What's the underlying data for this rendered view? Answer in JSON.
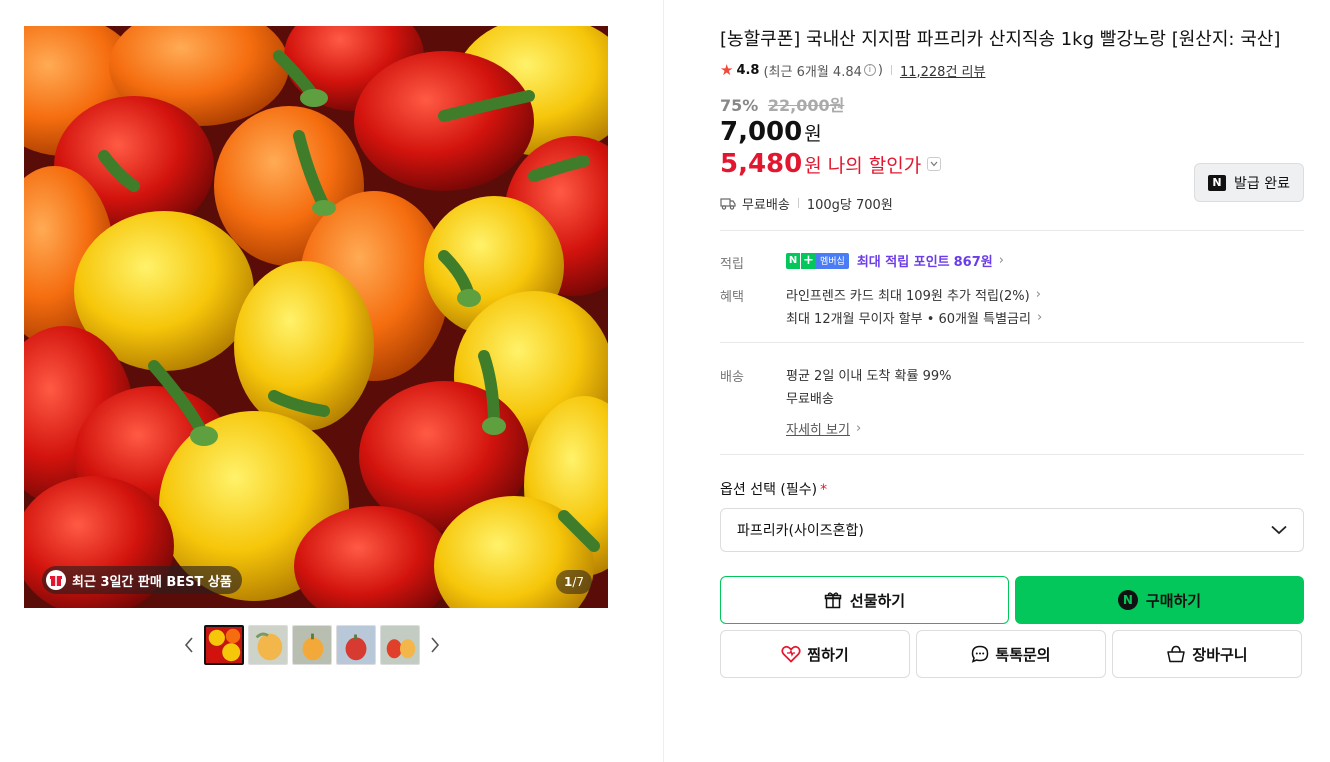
{
  "gallery": {
    "best_badge": "최근 3일간 판매 BEST 상품",
    "counter_current": "1",
    "counter_total": "/7",
    "thumb_count": 5,
    "active_thumb": 0
  },
  "product": {
    "title": "[농할쿠폰] 국내산 지지팜 파프리카 산지직송 1kg 빨강노랑 [원산지: 국산]",
    "rating": "4.8",
    "recent_rating": "(최근 6개월 4.84",
    "recent_rating_close": ")",
    "review_count": "11,228건 리뷰",
    "discount_rate": "75%",
    "original_price": "22,000원",
    "price": "7,000",
    "price_unit": "원",
    "my_price": "5,480",
    "my_price_unit": "원",
    "my_price_label": "나의 할인가",
    "coupon_button": "발급 완료",
    "shipping": "무료배송",
    "unit_price": "100g당 700원"
  },
  "benefits": {
    "points_label": "적립",
    "membership_badge": "멤버십",
    "max_points_text": "최대 적립 포인트",
    "max_points_value": "867원",
    "benefit_label": "혜택",
    "benefit_1": "라인프렌즈 카드 최대 109원 추가 적립(2%)",
    "benefit_2": "최대 12개월 무이자 할부 • 60개월 특별금리"
  },
  "delivery": {
    "label": "배송",
    "line_1": "평균 2일 이내 도착 확률 99%",
    "line_2": "무료배송",
    "more": "자세히 보기"
  },
  "options": {
    "label": "옵션 선택 (필수)",
    "required_mark": "*",
    "selected": "파프리카(사이즈혼합)"
  },
  "actions": {
    "gift": "선물하기",
    "buy": "구매하기",
    "wish": "찜하기",
    "talk": "톡톡문의",
    "cart": "장바구니"
  },
  "colors": {
    "naver_green": "#03c75a",
    "sale_red": "#e2172f",
    "point_purple": "#6b3de8"
  }
}
